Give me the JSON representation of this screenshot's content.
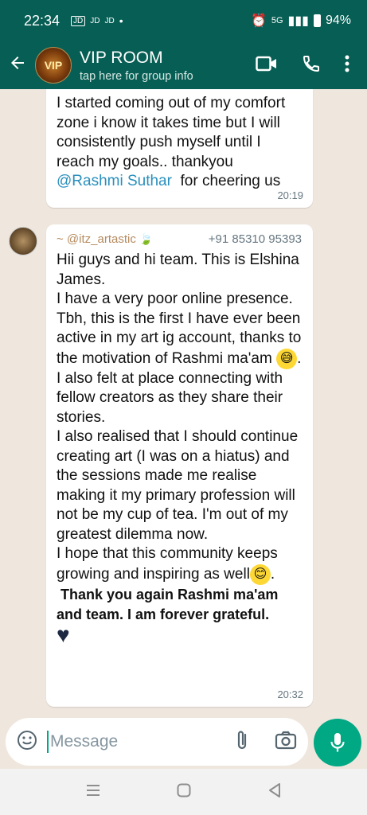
{
  "status_bar": {
    "time": "22:34",
    "carrier_icons": [
      "JD",
      "JD",
      "JD"
    ],
    "dot": "•",
    "network": "5G",
    "battery": "94%"
  },
  "header": {
    "title": "VIP ROOM",
    "subtitle": "tap here for group info",
    "avatar_text": "VIP"
  },
  "messages": [
    {
      "text_pre": "I started coming out of my comfort zone i know it takes time but I will consistently push myself until I reach my goals.. thankyou ",
      "mention": "@Rashmi Suthar",
      "text_post": "  for cheering us",
      "time": "20:19"
    },
    {
      "sender": "~ @itz_artastic",
      "phone": "+91 85310 95393",
      "p1": "Hii guys and hi team. This is Elshina James.\nI have a very poor online presence. Tbh, this is the first I have ever been active in my art ig account, thanks to the motivation of Rashmi ma'am",
      "p2": "I also felt at place connecting with fellow creators as they share their stories.\nI also realised that I should continue creating art (I was on a hiatus) and the sessions made me realise making it my primary profession will not be my cup of tea. I'm out of my greatest dilemma now.\nI hope that this community keeps growing and inspiring as well",
      "p3": " Thank you again Rashmi ma'am and team. I am forever grateful.",
      "time": "20:32"
    }
  ],
  "composer": {
    "placeholder": "Message"
  },
  "colors": {
    "header": "#075e54",
    "accent": "#00a884",
    "chat_bg": "#efe7de",
    "mention": "#2a8fbd"
  }
}
